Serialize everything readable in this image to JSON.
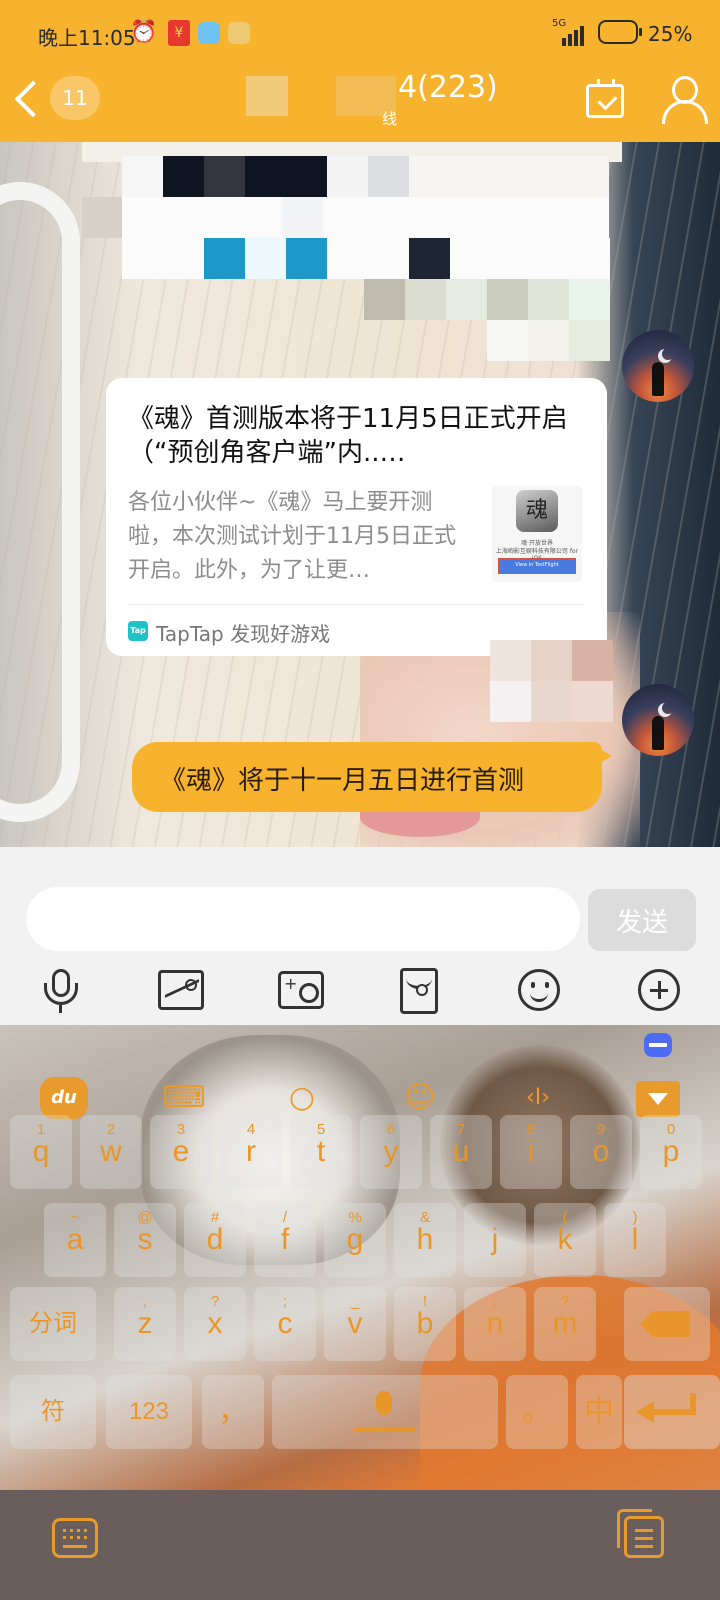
{
  "status_bar": {
    "time": "晚上11:05",
    "network": "5G",
    "battery": "25%"
  },
  "header": {
    "unread_count": "11",
    "title": "4(223)",
    "subtitle": "线"
  },
  "messages": [
    {
      "type": "link_card",
      "title": "《魂》首测版本将于11月5日正式开启（“预创角客户端”内..…",
      "description": "各位小伙伴~《魂》马上要开测啦，本次测试计划于11月5日正式开启。此外，为了让更…",
      "thumbnail": {
        "logo_text": "魂",
        "line1": "魂·开放世界",
        "line2": "上海绚影互娱科技有限公司 for iOS",
        "button": "View in TestFlight"
      },
      "source_icon": "Tap",
      "source": "TapTap 发现好游戏"
    },
    {
      "type": "text",
      "text": "《魂》将于十一月五日进行首测"
    }
  ],
  "input": {
    "placeholder": "",
    "send_label": "发送"
  },
  "keyboard": {
    "logo": "du",
    "row1": [
      {
        "key": "q",
        "alt": "1"
      },
      {
        "key": "w",
        "alt": "2"
      },
      {
        "key": "e",
        "alt": "3"
      },
      {
        "key": "r",
        "alt": "4"
      },
      {
        "key": "t",
        "alt": "5"
      },
      {
        "key": "y",
        "alt": "6"
      },
      {
        "key": "u",
        "alt": "7"
      },
      {
        "key": "i",
        "alt": "8"
      },
      {
        "key": "o",
        "alt": "9"
      },
      {
        "key": "p",
        "alt": "0"
      }
    ],
    "row2": [
      {
        "key": "a",
        "alt": "~"
      },
      {
        "key": "s",
        "alt": "@"
      },
      {
        "key": "d",
        "alt": "#"
      },
      {
        "key": "f",
        "alt": "/"
      },
      {
        "key": "g",
        "alt": "%"
      },
      {
        "key": "h",
        "alt": "&"
      },
      {
        "key": "j",
        "alt": "-"
      },
      {
        "key": "k",
        "alt": "("
      },
      {
        "key": "l",
        "alt": ")"
      }
    ],
    "row3_left": "分词",
    "row3": [
      {
        "key": "z",
        "alt": ","
      },
      {
        "key": "x",
        "alt": "?"
      },
      {
        "key": "c",
        "alt": ";"
      },
      {
        "key": "v",
        "alt": "_"
      },
      {
        "key": "b",
        "alt": "!"
      },
      {
        "key": "n",
        "alt": ":"
      },
      {
        "key": "m",
        "alt": "?"
      }
    ],
    "row4": {
      "symbols": "符",
      "numbers": "123",
      "comma": "，",
      "period": "。",
      "lang": "中"
    }
  }
}
